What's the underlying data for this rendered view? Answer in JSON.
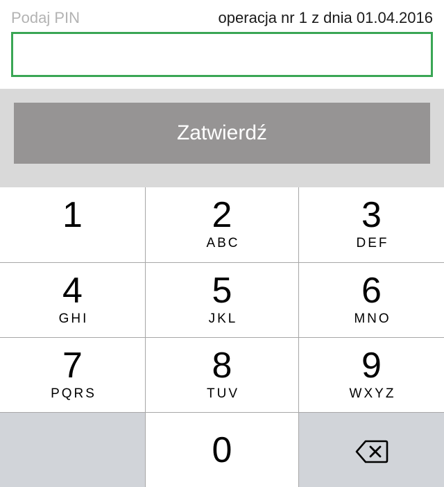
{
  "header": {
    "pin_label": "Podaj PIN",
    "operation_info": "operacja nr 1 z dnia 01.04.2016"
  },
  "pin_input": {
    "value": "",
    "placeholder": ""
  },
  "confirm_button": {
    "label": "Zatwierdź"
  },
  "keypad": {
    "keys": [
      {
        "digit": "1",
        "letters": ""
      },
      {
        "digit": "2",
        "letters": "ABC"
      },
      {
        "digit": "3",
        "letters": "DEF"
      },
      {
        "digit": "4",
        "letters": "GHI"
      },
      {
        "digit": "5",
        "letters": "JKL"
      },
      {
        "digit": "6",
        "letters": "MNO"
      },
      {
        "digit": "7",
        "letters": "PQRS"
      },
      {
        "digit": "8",
        "letters": "TUV"
      },
      {
        "digit": "9",
        "letters": "WXYZ"
      },
      {
        "digit": "0",
        "letters": ""
      }
    ],
    "backspace_icon": "backspace-icon"
  },
  "colors": {
    "input_border": "#3aa655",
    "confirm_button_bg": "#969494",
    "confirm_band_bg": "#d9d9d9",
    "key_bg": "#ffffff",
    "key_dark_bg": "#d1d4d9"
  }
}
